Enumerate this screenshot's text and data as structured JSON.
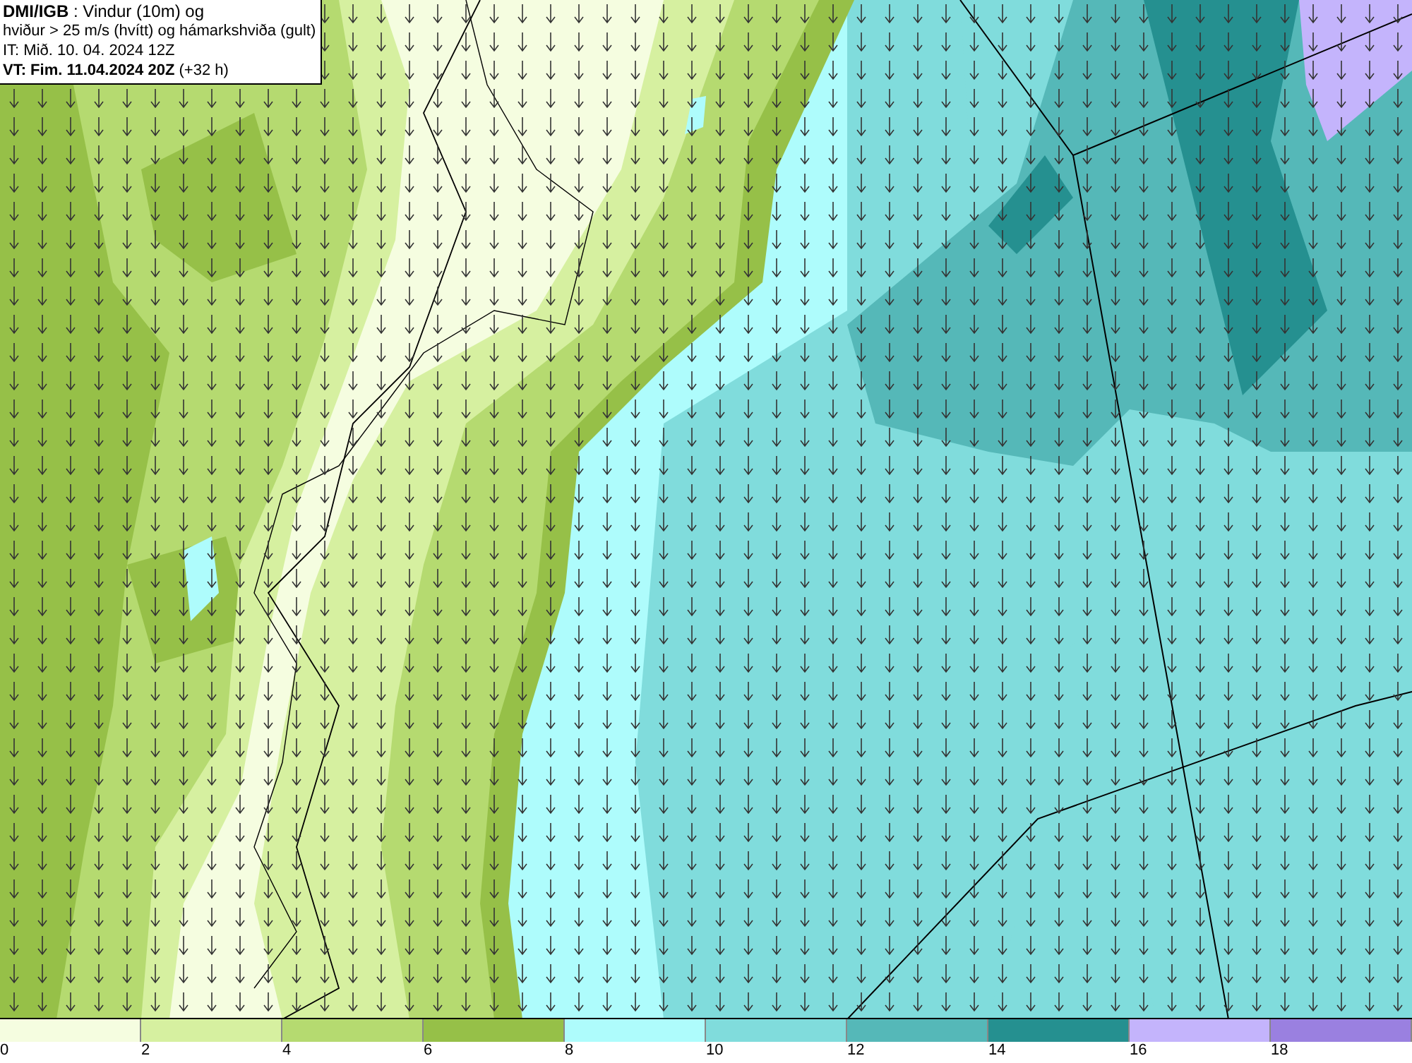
{
  "title_box": {
    "lines": [
      "**DMI/IGB** : Vindur (10m) og",
      "hviður > 25 m/s (hvítt) og hámarkshviða (gult)",
      "IT: Mið. 10. 04. 2024 12Z",
      "**VT: Fim. 11.04.2024 20Z** (+32 h)"
    ]
  },
  "legend": [
    {
      "color": "#f5fde0",
      "label": "0"
    },
    {
      "color": "#d6f0a0",
      "label": "2"
    },
    {
      "color": "#b5da70",
      "label": "4"
    },
    {
      "color": "#96c048",
      "label": "6"
    },
    {
      "color": "#aefcfc",
      "label": "8"
    },
    {
      "color": "#80dcdc",
      "label": "10"
    },
    {
      "color": "#55b8b8",
      "label": "12"
    },
    {
      "color": "#259090",
      "label": "14"
    },
    {
      "color": "#c4b4fc",
      "label": "16"
    },
    {
      "color": "#9a80e0",
      "label": "18"
    }
  ]
}
